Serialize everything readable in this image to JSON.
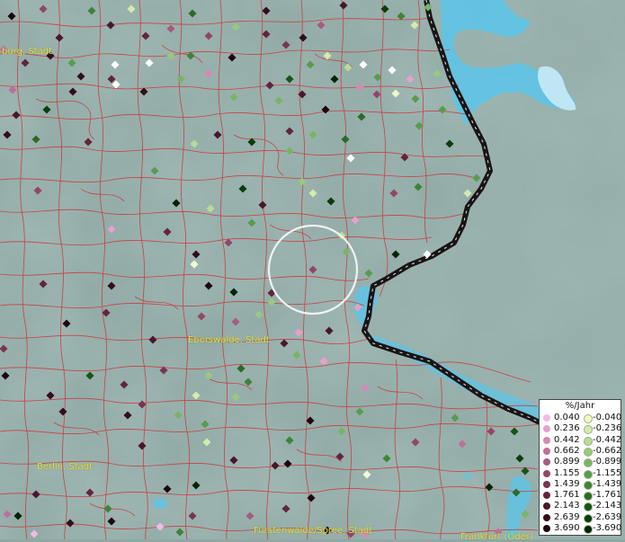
{
  "place_labels": [
    {
      "name": "label-brandenburg",
      "text": "burg, Stadt"
    },
    {
      "name": "label-eberswalde",
      "text": "Eberswalde, Stadt"
    },
    {
      "name": "label-berlin",
      "text": "Berlin, Stadt"
    },
    {
      "name": "label-fuerstenwalde",
      "text": "Fürstenwalde/Spree, Stadt"
    },
    {
      "name": "label-frankfurt",
      "text": "Frankfurt (Oder)"
    }
  ],
  "legend": {
    "title": "%/Jahr",
    "positive": [
      {
        "label": "0.040",
        "color": "#f5b8e6"
      },
      {
        "label": "0.236",
        "color": "#e8a0cc"
      },
      {
        "label": "0.442",
        "color": "#d688b4"
      },
      {
        "label": "0.662",
        "color": "#c07098"
      },
      {
        "label": "0.899",
        "color": "#a85a80"
      },
      {
        "label": "1.155",
        "color": "#924668"
      },
      {
        "label": "1.439",
        "color": "#7a3452"
      },
      {
        "label": "1.761",
        "color": "#62243e"
      },
      {
        "label": "2.143",
        "color": "#4a162c"
      },
      {
        "label": "2.639",
        "color": "#340c1c"
      },
      {
        "label": "3.690",
        "color": "#1e040e"
      }
    ],
    "negative": [
      {
        "label": "-0.040",
        "color": "#f2f8c4"
      },
      {
        "label": "-0.236",
        "color": "#d6eaac"
      },
      {
        "label": "-0.442",
        "color": "#b8dc96"
      },
      {
        "label": "-0.662",
        "color": "#98c97e"
      },
      {
        "label": "-0.899",
        "color": "#78b466"
      },
      {
        "label": "-1.155",
        "color": "#589c4e"
      },
      {
        "label": "-1.439",
        "color": "#3e8438"
      },
      {
        "label": "-1.761",
        "color": "#286c26"
      },
      {
        "label": "-2.143",
        "color": "#165418"
      },
      {
        "label": "-2.639",
        "color": "#0a3c0c"
      },
      {
        "label": "-3.690",
        "color": "#042404"
      }
    ]
  },
  "colors": {
    "background": "#8fa8a4",
    "district_borders": "#d03030",
    "national_border": "#1a1414",
    "water": "#5ec4e6",
    "selection_circle": "#ffffff",
    "label_text": "#e8e04a"
  }
}
